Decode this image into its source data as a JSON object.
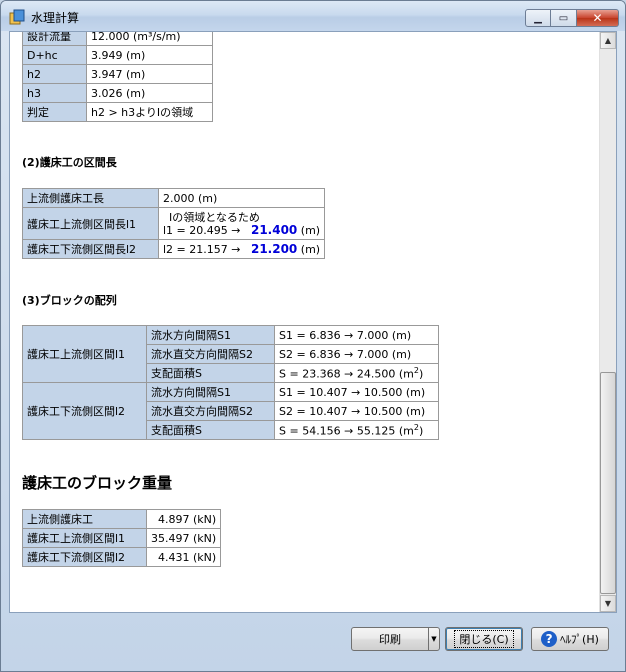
{
  "window": {
    "title": "水理計算"
  },
  "top_table": [
    {
      "label": "設計流量",
      "value": "12.000 (m³/s/m)"
    },
    {
      "label": "D+hc",
      "value": "3.949 (m)"
    },
    {
      "label": "h2",
      "value": "3.947 (m)"
    },
    {
      "label": "h3",
      "value": "3.026 (m)"
    },
    {
      "label": "判定",
      "value": "h2 > h3よりⅠの領域"
    }
  ],
  "section2": {
    "title": "(2)護床工の区間長",
    "rows": [
      {
        "label": "上流側護床工長",
        "value": "2.000 (m)"
      },
      {
        "label": "護床工上流側区間長l1",
        "line1": "Ⅰの領域となるため",
        "prefix": "l1 = 20.495 →",
        "result": "21.400",
        "unit": "(m)"
      },
      {
        "label": "護床工下流側区間長l2",
        "prefix": "l2 = 21.157 →",
        "result": "21.200",
        "unit": "(m)"
      }
    ]
  },
  "section3": {
    "title": "(3)ブロックの配列",
    "groups": [
      {
        "label": "護床工上流側区間l1",
        "rows": [
          {
            "label": "流水方向間隔S1",
            "value": "S1 = 6.836 →  7.000 (m)"
          },
          {
            "label": "流水直交方向間隔S2",
            "value": "S2 = 6.836 →  7.000 (m)"
          },
          {
            "label": "支配面積S",
            "value": "S = 23.368 →  24.500 (m",
            "sup": "2",
            "tail": ")"
          }
        ]
      },
      {
        "label": "護床工下流側区間l2",
        "rows": [
          {
            "label": "流水方向間隔S1",
            "value": "S1 = 10.407 →  10.500 (m)"
          },
          {
            "label": "流水直交方向間隔S2",
            "value": "S2 = 10.407 →  10.500 (m)"
          },
          {
            "label": "支配面積S",
            "value": "S = 54.156 →  55.125 (m",
            "sup": "2",
            "tail": ")"
          }
        ]
      }
    ]
  },
  "weights": {
    "title": "護床工のブロック重量",
    "rows": [
      {
        "label": "上流側護床工",
        "value": "4.897 (kN)"
      },
      {
        "label": "護床工上流側区間l1",
        "value": "35.497 (kN)"
      },
      {
        "label": "護床工下流側区間l2",
        "value": "4.431 (kN)"
      }
    ]
  },
  "buttons": {
    "print": "印刷",
    "close": "閉じる(C)",
    "help": "ﾍﾙﾌﾟ(H)"
  },
  "colors": {
    "label_bg": "#c3d4e8",
    "result": "#0000d8"
  }
}
